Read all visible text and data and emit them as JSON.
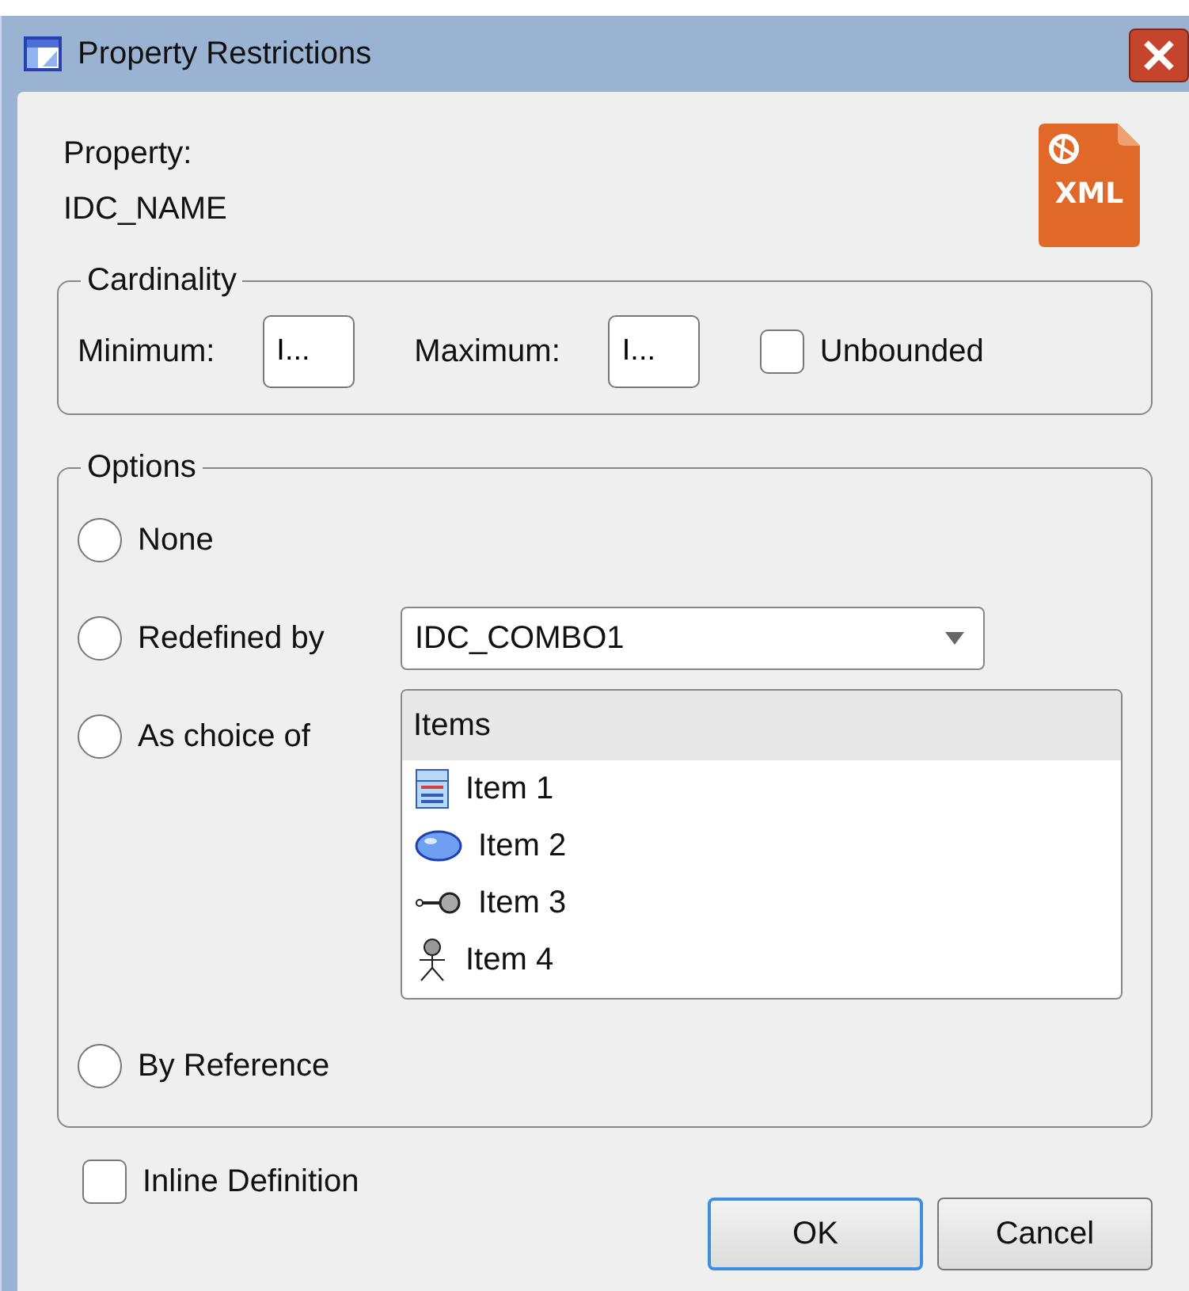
{
  "window": {
    "title": "Property Restrictions"
  },
  "property": {
    "label": "Property:",
    "value": "IDC_NAME",
    "file_badge": "XML"
  },
  "cardinality": {
    "legend": "Cardinality",
    "minimum": {
      "label": "Minimum:",
      "value": "I..."
    },
    "maximum": {
      "label": "Maximum:",
      "value": "I..."
    },
    "unbounded": {
      "label": "Unbounded",
      "checked": false
    }
  },
  "options": {
    "legend": "Options",
    "choices": [
      {
        "label": "None",
        "selected": false,
        "kind": "plain"
      },
      {
        "label": "Redefined by",
        "selected": false,
        "kind": "combo",
        "combo_value": "IDC_COMBO1"
      },
      {
        "label": "As choice of",
        "selected": false,
        "kind": "list",
        "list_header": "Items",
        "items": [
          {
            "label": "Item 1",
            "kind": "class"
          },
          {
            "label": "Item 2",
            "kind": "usecase"
          },
          {
            "label": "Item 3",
            "kind": "interface"
          },
          {
            "label": "Item 4",
            "kind": "actor"
          }
        ]
      },
      {
        "label": "By Reference",
        "selected": false,
        "kind": "plain"
      }
    ]
  },
  "inline_definition": {
    "label": "Inline Definition",
    "checked": false
  },
  "buttons": [
    {
      "label": "OK",
      "default": true
    },
    {
      "label": "Cancel",
      "default": false
    }
  ]
}
